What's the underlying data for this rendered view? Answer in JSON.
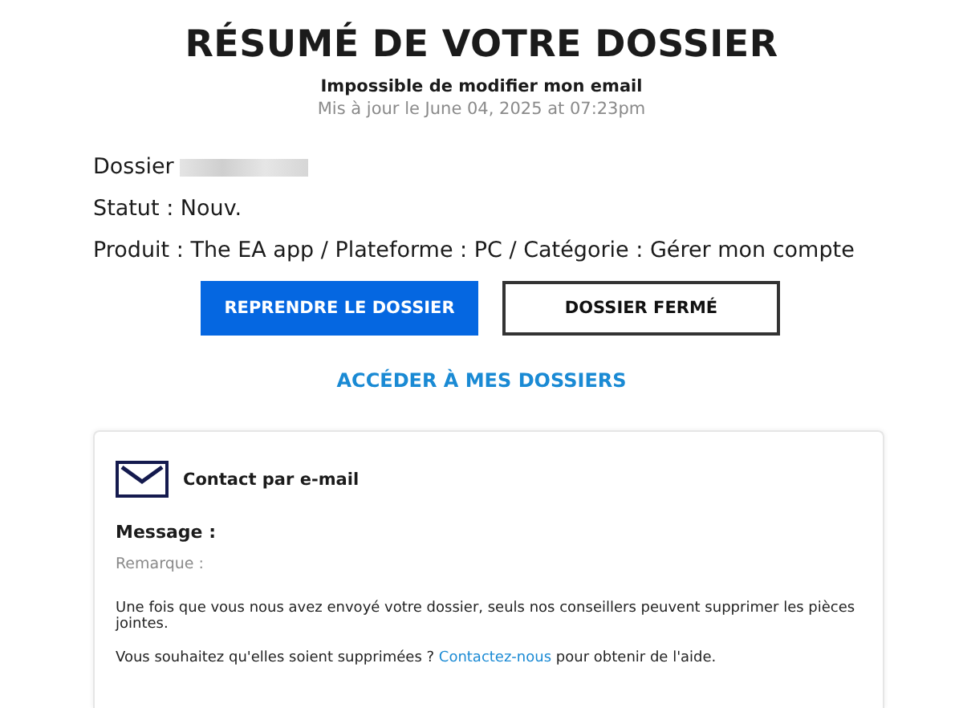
{
  "header": {
    "title": "RÉSUMÉ DE VOTRE DOSSIER",
    "subtitle": "Impossible de modifier mon email",
    "updated": "Mis à jour le June 04, 2025 at 07:23pm"
  },
  "details": {
    "case_label": "Dossier",
    "status": "Statut : Nouv.",
    "product": "Produit : The EA app / Plateforme : PC / Catégorie : Gérer mon compte"
  },
  "buttons": [
    {
      "label": "REPRENDRE LE DOSSIER",
      "kind": "primary"
    },
    {
      "label": "DOSSIER FERMÉ",
      "kind": "outline"
    }
  ],
  "cases_link": "ACCÉDER À MES DOSSIERS",
  "card": {
    "title": "Contact par e-mail",
    "message_label": "Message :",
    "remark": "Remarque :",
    "note": "Une fois que vous nous avez envoyé votre dossier, seuls nos conseillers peuvent supprimer les pièces jointes.",
    "help": {
      "before": "Vous souhaitez qu'elles soient supprimées ?",
      "link": "Contactez-nous",
      "after": "pour obtenir de l'aide."
    }
  }
}
